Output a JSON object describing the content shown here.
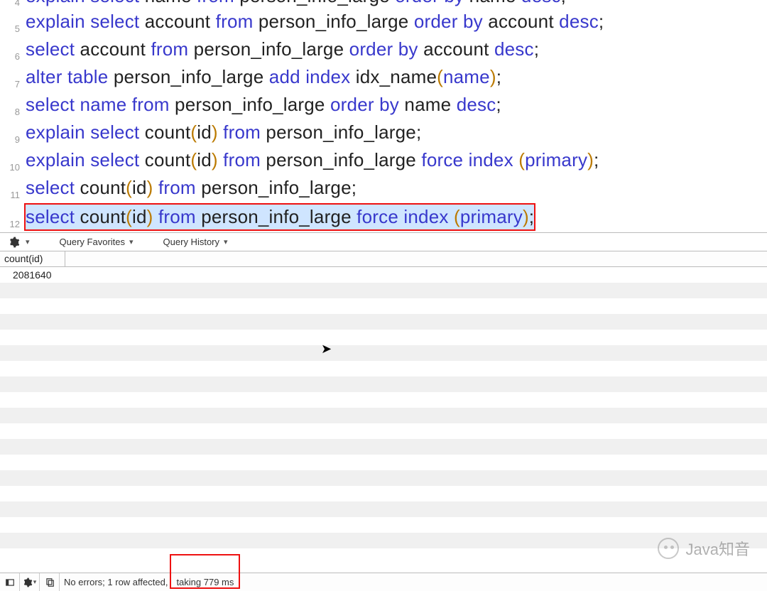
{
  "editor": {
    "lines": [
      {
        "n": 4,
        "cutoff": true,
        "highlighted": false,
        "tokens": [
          [
            "kw",
            "explain select"
          ],
          [
            "pl",
            " name "
          ],
          [
            "kw",
            "from"
          ],
          [
            "pl",
            " person_info_large "
          ],
          [
            "kw",
            "order by"
          ],
          [
            "pl",
            " name "
          ],
          [
            "kw",
            "desc"
          ],
          [
            "pl",
            ";"
          ]
        ]
      },
      {
        "n": 5,
        "cutoff": false,
        "highlighted": false,
        "tokens": [
          [
            "kw",
            "explain select"
          ],
          [
            "pl",
            " account "
          ],
          [
            "kw",
            "from"
          ],
          [
            "pl",
            " person_info_large "
          ],
          [
            "kw",
            "order by"
          ],
          [
            "pl",
            " account "
          ],
          [
            "kw",
            "desc"
          ],
          [
            "pl",
            ";"
          ]
        ]
      },
      {
        "n": 6,
        "cutoff": false,
        "highlighted": false,
        "tokens": [
          [
            "kw",
            "select"
          ],
          [
            "pl",
            " account "
          ],
          [
            "kw",
            "from"
          ],
          [
            "pl",
            " person_info_large "
          ],
          [
            "kw",
            "order by"
          ],
          [
            "pl",
            " account "
          ],
          [
            "kw",
            "desc"
          ],
          [
            "pl",
            ";"
          ]
        ]
      },
      {
        "n": 7,
        "cutoff": false,
        "highlighted": false,
        "tokens": [
          [
            "kw",
            "alter table"
          ],
          [
            "pl",
            " person_info_large "
          ],
          [
            "kw",
            "add index"
          ],
          [
            "pl",
            " idx_name"
          ],
          [
            "par",
            "("
          ],
          [
            "kw",
            "name"
          ],
          [
            "par",
            ")"
          ],
          [
            "pl",
            ";"
          ]
        ]
      },
      {
        "n": 8,
        "cutoff": false,
        "highlighted": false,
        "tokens": [
          [
            "kw",
            "select name from"
          ],
          [
            "pl",
            " person_info_large "
          ],
          [
            "kw",
            "order by"
          ],
          [
            "pl",
            " name "
          ],
          [
            "kw",
            "desc"
          ],
          [
            "pl",
            ";"
          ]
        ]
      },
      {
        "n": 9,
        "cutoff": false,
        "highlighted": false,
        "tokens": [
          [
            "kw",
            "explain select"
          ],
          [
            "pl",
            " count"
          ],
          [
            "par",
            "("
          ],
          [
            "pl",
            "id"
          ],
          [
            "par",
            ")"
          ],
          [
            "pl",
            " "
          ],
          [
            "kw",
            "from"
          ],
          [
            "pl",
            " person_info_large;"
          ]
        ]
      },
      {
        "n": 10,
        "cutoff": false,
        "highlighted": false,
        "tokens": [
          [
            "kw",
            "explain select"
          ],
          [
            "pl",
            " count"
          ],
          [
            "par",
            "("
          ],
          [
            "pl",
            "id"
          ],
          [
            "par",
            ")"
          ],
          [
            "pl",
            " "
          ],
          [
            "kw",
            "from"
          ],
          [
            "pl",
            " person_info_large "
          ],
          [
            "kw",
            "force index"
          ],
          [
            "pl",
            " "
          ],
          [
            "par",
            "("
          ],
          [
            "kw",
            "primary"
          ],
          [
            "par",
            ")"
          ],
          [
            "pl",
            ";"
          ]
        ]
      },
      {
        "n": 11,
        "cutoff": false,
        "highlighted": false,
        "tokens": [
          [
            "kw",
            "select"
          ],
          [
            "pl",
            " count"
          ],
          [
            "par",
            "("
          ],
          [
            "pl",
            "id"
          ],
          [
            "par",
            ")"
          ],
          [
            "pl",
            " "
          ],
          [
            "kw",
            "from"
          ],
          [
            "pl",
            " person_info_large;"
          ]
        ]
      },
      {
        "n": 12,
        "cutoff": false,
        "highlighted": true,
        "tokens": [
          [
            "kw",
            "select"
          ],
          [
            "pl",
            " count"
          ],
          [
            "par",
            "("
          ],
          [
            "pl",
            "id"
          ],
          [
            "par",
            ")"
          ],
          [
            "pl",
            " "
          ],
          [
            "kw",
            "from"
          ],
          [
            "pl",
            " person_info_large "
          ],
          [
            "kw",
            "force index"
          ],
          [
            "pl",
            " "
          ],
          [
            "par",
            "("
          ],
          [
            "kw",
            "primary"
          ],
          [
            "par",
            ")"
          ],
          [
            "pl",
            ";"
          ]
        ]
      }
    ]
  },
  "results_bar": {
    "favorites_label": "Query Favorites",
    "history_label": "Query History"
  },
  "results": {
    "columns": [
      "count(id)"
    ],
    "rows": [
      [
        "2081640"
      ]
    ],
    "blank_row_count": 18
  },
  "statusbar": {
    "message": "No errors; 1 row affected,",
    "timing": "taking 779 ms"
  },
  "watermark_text": "Java知音"
}
